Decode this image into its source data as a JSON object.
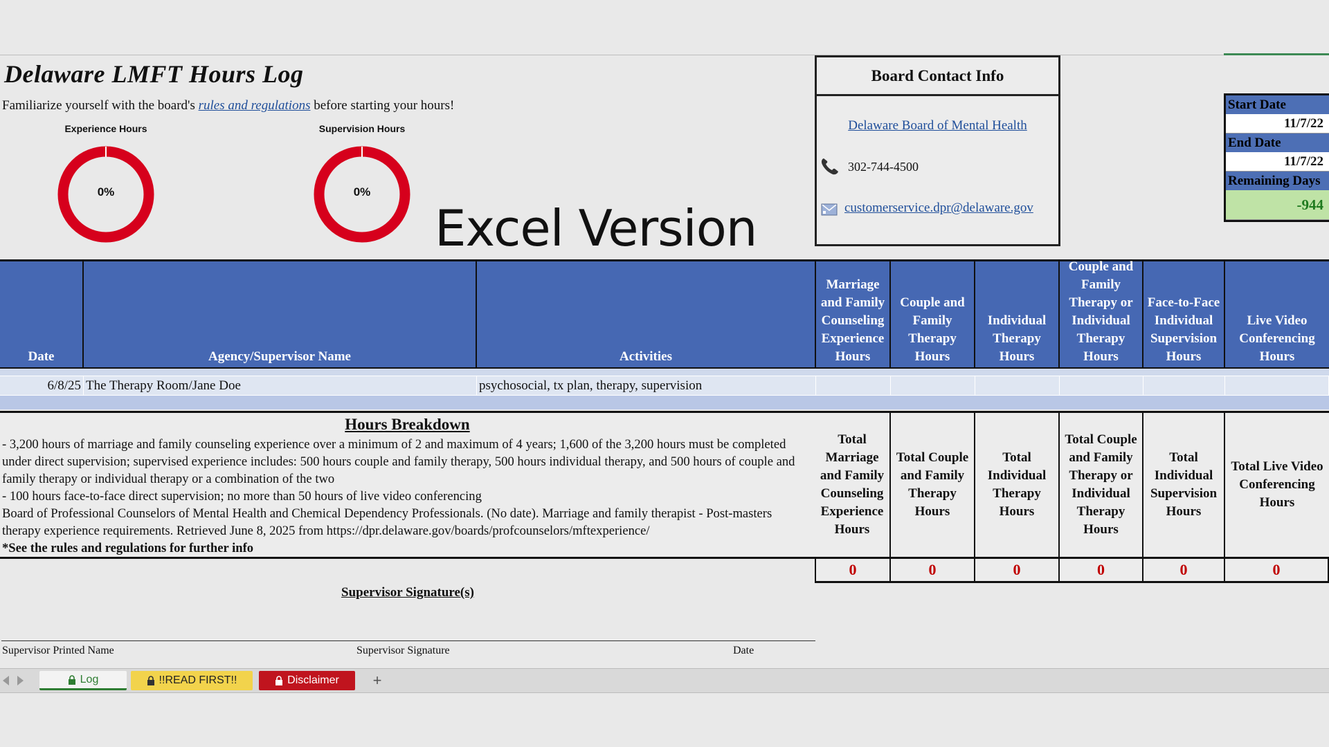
{
  "title": "Delaware LMFT Hours Log",
  "intro": {
    "before": "Familiarize yourself with the board's ",
    "link": "rules and regulations",
    "after": " before starting your hours!"
  },
  "donuts": [
    {
      "title": "Experience Hours",
      "percent_label": "0%",
      "progress": 0
    },
    {
      "title": "Supervision Hours",
      "percent_label": "0%",
      "progress": 0
    }
  ],
  "overlay_text": "Excel Version",
  "contact": {
    "title": "Board Contact Info",
    "board_link": "Delaware Board of Mental Health",
    "phone": "302-744-4500",
    "email": "customerservice.dpr@delaware.gov",
    "phone_icon": "phone-icon",
    "mail_icon": "envelope-icon"
  },
  "dates": {
    "start_label": "Start Date",
    "start_value": "11/7/22",
    "end_label": "End Date",
    "end_value": "11/7/22",
    "remaining_label": "Remaining Days",
    "remaining_value": "-944"
  },
  "table": {
    "headers": {
      "date": "Date",
      "agency": "Agency/Supervisor Name",
      "activities": "Activities",
      "mfc": "Marriage and Family Counseling Experience Hours",
      "cft": "Couple and Family Therapy Hours",
      "it": "Individual Therapy Hours",
      "cfit": "Couple and Family Therapy or Individual Therapy Hours",
      "ftf": "Face-to-Face Individual Supervision Hours",
      "lvc": "Live Video Conferencing Hours"
    },
    "rows": [
      {
        "date": "6/8/25",
        "agency": "The Therapy Room/Jane Doe",
        "activities": "psychosocial, tx plan, therapy, supervision"
      }
    ]
  },
  "breakdown": {
    "title": "Hours Breakdown",
    "line1": "- 3,200 hours of marriage and family counseling experience over a minimum of 2 and maximum of 4 years; 1,600 of the 3,200 hours must be completed under direct supervision; supervised experience includes: 500 hours couple and family therapy, 500 hours individual therapy, and 500 hours of couple and family therapy or individual therapy or a combination of the two",
    "line2": "- 100 hours face-to-face direct supervision; no more than 50 hours of live video conferencing",
    "line3": "Board of Professional Counselors of Mental Health and Chemical Dependency Professionals. (No date). Marriage and family therapist - Post-masters therapy experience requirements. Retrieved June 8, 2025 from https://dpr.delaware.gov/boards/profcounselors/mftexperience/",
    "note": "*See the rules and regulations for further info"
  },
  "totals": {
    "mfc": "Total Marriage and Family Counseling Experience Hours",
    "cft": "Total Couple and Family Therapy Hours",
    "it": "Total Individual Therapy Hours",
    "cfit": "Total Couple and Family Therapy or Individual Therapy Hours",
    "ftf": "Total Individual Supervision Hours",
    "lvc": "Total Live Video Conferencing Hours"
  },
  "sums": {
    "mfc": "0",
    "cft": "0",
    "it": "0",
    "cfit": "0",
    "ftf": "0",
    "lvc": "0"
  },
  "signature": {
    "title": "Supervisor Signature(s)",
    "printed_name": "Supervisor Printed Name",
    "signature": "Supervisor Signature",
    "date": "Date"
  },
  "tabs": {
    "log": "Log",
    "read_first": "!!READ FIRST!!",
    "disclaimer": "Disclaimer",
    "add": "+"
  },
  "colors": {
    "header_blue": "#4668b3",
    "donut_red": "#d6001c",
    "total_red": "#c00000",
    "remaining_green": "#1f7a1f"
  }
}
